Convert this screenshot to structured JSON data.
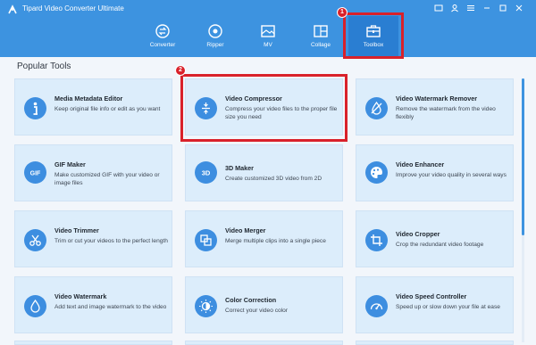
{
  "app": {
    "title": "Tipard Video Converter Ultimate"
  },
  "nav": {
    "items": [
      {
        "label": "Converter",
        "icon": "converter-icon"
      },
      {
        "label": "Ripper",
        "icon": "ripper-icon"
      },
      {
        "label": "MV",
        "icon": "mv-icon"
      },
      {
        "label": "Collage",
        "icon": "collage-icon"
      },
      {
        "label": "Toolbox",
        "icon": "toolbox-icon",
        "active": true
      }
    ]
  },
  "section": {
    "title": "Popular Tools"
  },
  "tools": [
    {
      "title": "Media Metadata Editor",
      "desc": "Keep original file info or edit as you want",
      "icon": "info-icon"
    },
    {
      "title": "Video Compressor",
      "desc": "Compress your video files to the proper file size you need",
      "icon": "compress-icon"
    },
    {
      "title": "Video Watermark Remover",
      "desc": "Remove the watermark from the video flexibly",
      "icon": "watermark-remover-icon"
    },
    {
      "title": "GIF Maker",
      "desc": "Make customized GIF with your video or image files",
      "icon": "gif-icon"
    },
    {
      "title": "3D Maker",
      "desc": "Create customized 3D video from 2D",
      "icon": "3d-icon"
    },
    {
      "title": "Video Enhancer",
      "desc": "Improve your video quality in several ways",
      "icon": "palette-icon"
    },
    {
      "title": "Video Trimmer",
      "desc": "Trim or cut your videos to the perfect length",
      "icon": "scissors-icon"
    },
    {
      "title": "Video Merger",
      "desc": "Merge multiple clips into a single piece",
      "icon": "merge-icon"
    },
    {
      "title": "Video Cropper",
      "desc": "Crop the redundant video footage",
      "icon": "crop-icon"
    },
    {
      "title": "Video Watermark",
      "desc": "Add text and image watermark to the video",
      "icon": "droplet-icon"
    },
    {
      "title": "Color Correction",
      "desc": "Correct your video color",
      "icon": "color-correction-icon"
    },
    {
      "title": "Video Speed Controller",
      "desc": "Speed up or slow down your file at ease",
      "icon": "speed-icon"
    }
  ],
  "annotations": [
    {
      "badge": "1",
      "target": "Toolbox"
    },
    {
      "badge": "2",
      "target": "Video Compressor"
    }
  ],
  "colors": {
    "header": "#3d93e0",
    "nav_active": "#2a7ed2",
    "card": "#dcedfb",
    "icon_bg": "#3d8ee0",
    "highlight": "#d9212a"
  }
}
